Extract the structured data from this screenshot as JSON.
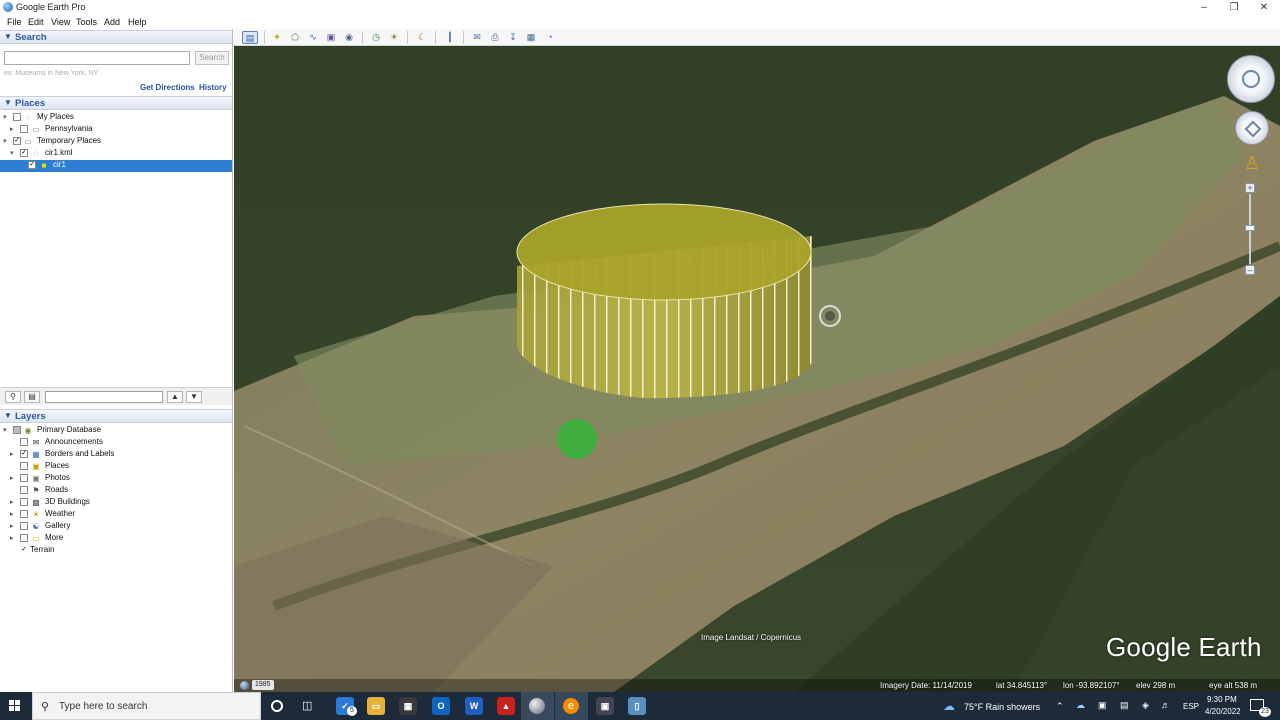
{
  "window": {
    "title": "Google Earth Pro"
  },
  "menu": [
    "File",
    "Edit",
    "View",
    "Tools",
    "Add",
    "Help"
  ],
  "search": {
    "header": "Search",
    "placeholder": "",
    "button": "Search",
    "hint": "ex: Museums in New York, NY",
    "get_directions": "Get Directions",
    "history": "History"
  },
  "places": {
    "header": "Places",
    "items": [
      {
        "label": "My Places",
        "checked": false,
        "expanded": true
      },
      {
        "label": "Pennsylvania",
        "checked": false,
        "expanded": false
      },
      {
        "label": "Temporary Places",
        "checked": true,
        "expanded": true
      },
      {
        "label": "cir1.kml",
        "checked": true,
        "expanded": true
      },
      {
        "label": "cir1",
        "checked": true,
        "selected": true
      }
    ]
  },
  "layers": {
    "header": "Layers",
    "items": [
      {
        "label": "Primary Database",
        "checked": "partial",
        "expanded": true
      },
      {
        "label": "Announcements",
        "checked": false
      },
      {
        "label": "Borders and Labels",
        "checked": true
      },
      {
        "label": "Places",
        "checked": false
      },
      {
        "label": "Photos",
        "checked": false
      },
      {
        "label": "Roads",
        "checked": false
      },
      {
        "label": "3D Buildings",
        "checked": false
      },
      {
        "label": "Weather",
        "checked": false
      },
      {
        "label": "Gallery",
        "checked": false
      },
      {
        "label": "More",
        "checked": false
      },
      {
        "label": "Terrain",
        "checked": true
      }
    ]
  },
  "map": {
    "attribution": "Image Landsat / Copernicus",
    "year": "1985",
    "imagery_date": "Imagery Date: 11/14/2019",
    "lat": "lat  34.845113°",
    "lon": "lon  -93.892107°",
    "elev": "elev  298 m",
    "eye_alt": "eye alt  538 m",
    "logo": "Google Earth"
  },
  "taskbar": {
    "search_placeholder": "Type here to search",
    "weather": "75°F  Rain showers",
    "lang": "ESP",
    "time": "9:30 PM",
    "date": "4/20/2022",
    "badge": "5",
    "notif": "23"
  }
}
